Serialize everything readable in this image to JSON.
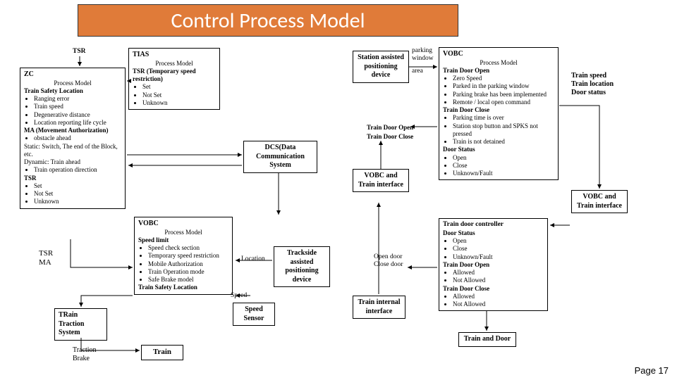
{
  "title": "Control Process Model",
  "footer": "Page  17",
  "labels": {
    "tsr_top": "TSR",
    "parking_window": "parking\nwindow",
    "parking_area": "area",
    "train_outputs": "Train speed\nTrain location\nDoor status",
    "train_door_open": "Train Door Open",
    "train_door_close": "Train Door Close",
    "tsr_ma": "TSR\nMA",
    "location": "Location",
    "speed_sensor_in": "Speed",
    "open_close_door": "Open door\nClose door",
    "traction_brake": "Traction\nBrake"
  },
  "boxes": {
    "zc": {
      "title": "ZC",
      "pm": "Process Model",
      "h1": "Train Safety Location",
      "b1": [
        "Ranging error",
        "Train speed",
        "Degenerative distance",
        "Location reporting life cycle"
      ],
      "h2": "MA (Movement Authorization)",
      "b2": [
        "obstacle ahead"
      ],
      "static": "Static: Switch, The end of the Block, etc.",
      "dynamic": "Dynamic: Train ahead",
      "b3": [
        "Train operation direction"
      ],
      "h3": "TSR",
      "b4": [
        "Set",
        "Not Set",
        "Unknown"
      ]
    },
    "tias": {
      "title": "TIAS",
      "pm": "Process Model",
      "h1": "TSR (Temporary speed restriction)",
      "b1": [
        "Set",
        "Not Set",
        "Unknown"
      ]
    },
    "station_assist": "Station\nassisted\npositioning\ndevice",
    "vobc_right": {
      "title": "VOBC",
      "pm": "Process Model",
      "h1": "Train Door Open",
      "b1": [
        "Zero Speed",
        "Parked in the parking window",
        "Parking brake has been implemented",
        "Remote / local open command"
      ],
      "h2": "Train Door Close",
      "b2": [
        "Parking time is over",
        "Station stop button and SPKS not pressed",
        "Train is not detained"
      ],
      "h3": "Door Status",
      "b3": [
        "Open",
        "Close",
        "Unknown/Fault"
      ]
    },
    "dcs": "DCS(Data\nCommunication\nSystem",
    "vobc_train_iface_mid": "VOBC and\nTrain\ninterface",
    "vobc_train_iface_right": "VOBC and\nTrain\ninterface",
    "vobc_left": {
      "title": "VOBC",
      "pm": "Process Model",
      "h1": "Speed limit",
      "b1": [
        "Speed check section",
        "Temporary speed restriction",
        "Mobile Authorization",
        "Train Operation mode",
        "Safe Brake model"
      ],
      "h2": "Train Safety Location"
    },
    "door_ctrl": {
      "title": "Train  door controller",
      "h1": "Door Status",
      "b1": [
        "Open",
        "Close",
        "Unknown/Fault"
      ],
      "h2": "Train Door Open",
      "b2": [
        "Allowed",
        "Not Allowed"
      ],
      "h3": "Train Door Close",
      "b3": [
        "Allowed",
        "Not Allowed"
      ]
    },
    "traction_system": "TRain\nTraction\nSystem",
    "train": "Train",
    "trackside": "Trackside\nassisted\npositioning\ndevice",
    "speed_sensor": "Speed\nSensor",
    "train_internal": "Train\ninternal\ninterface",
    "train_and_door": "Train and\nDoor"
  }
}
